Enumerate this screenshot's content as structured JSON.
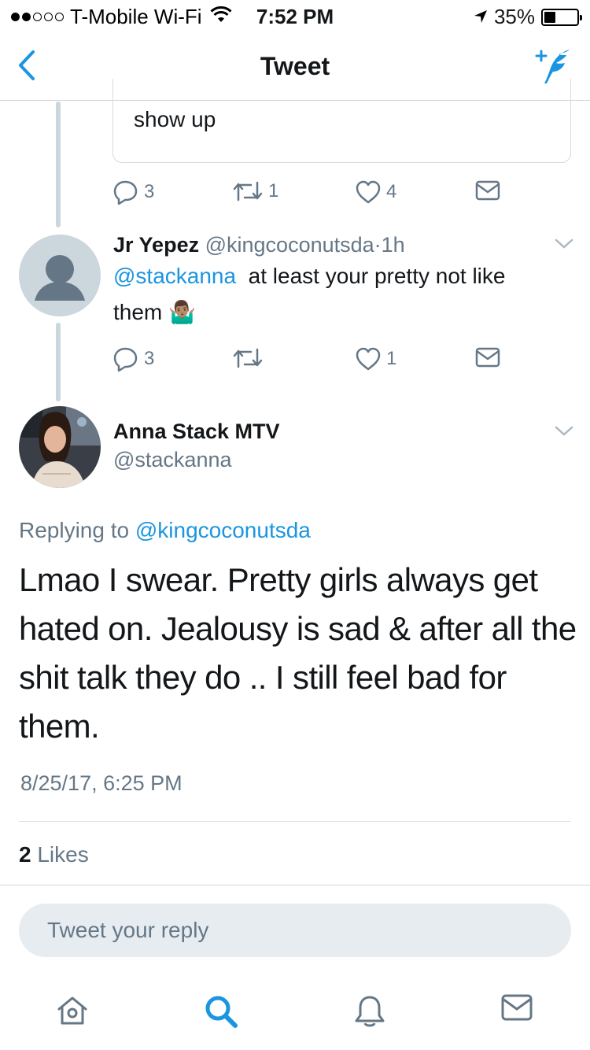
{
  "status_bar": {
    "carrier": "T-Mobile Wi-Fi",
    "time": "7:52 PM",
    "battery": "35%",
    "battery_level": 0.35,
    "signal_bars_filled": 2,
    "signal_bars_total": 5
  },
  "nav": {
    "title": "Tweet",
    "back_icon": "chevron-left-icon",
    "compose_icon": "compose-tweet-icon"
  },
  "quoted_fragment": {
    "text": "show up"
  },
  "tweet1_actions": {
    "replies": "3",
    "retweets": "1",
    "likes": "4"
  },
  "reply_tweet": {
    "name": "Jr Yepez",
    "handle": "@kingcoconutsda",
    "separator": "·",
    "time": "1h",
    "mention": "@stackanna",
    "text_line1": "at least your pretty not like",
    "text_line2": "them",
    "emoji": "🤷🏽‍♂️",
    "replies": "3",
    "retweets": "",
    "likes": "1"
  },
  "main_tweet": {
    "name": "Anna Stack MTV",
    "handle": "@stackanna",
    "replying_prefix": "Replying to",
    "replying_to": "@kingcoconutsda",
    "text": "Lmao I swear. Pretty girls always get hated on. Jealousy is sad & after all the shit talk they do .. I still feel bad for them.",
    "timestamp": "8/25/17, 6:25 PM",
    "likes_count": "2",
    "likes_label": "Likes"
  },
  "reply_bar": {
    "placeholder": "Tweet your reply"
  },
  "tab_bar": {
    "items": [
      "home-icon",
      "search-icon",
      "notifications-icon",
      "messages-icon"
    ]
  },
  "colors": {
    "accent": "#1b95e0",
    "secondary_text": "#657786",
    "border": "#d4dbe0"
  }
}
